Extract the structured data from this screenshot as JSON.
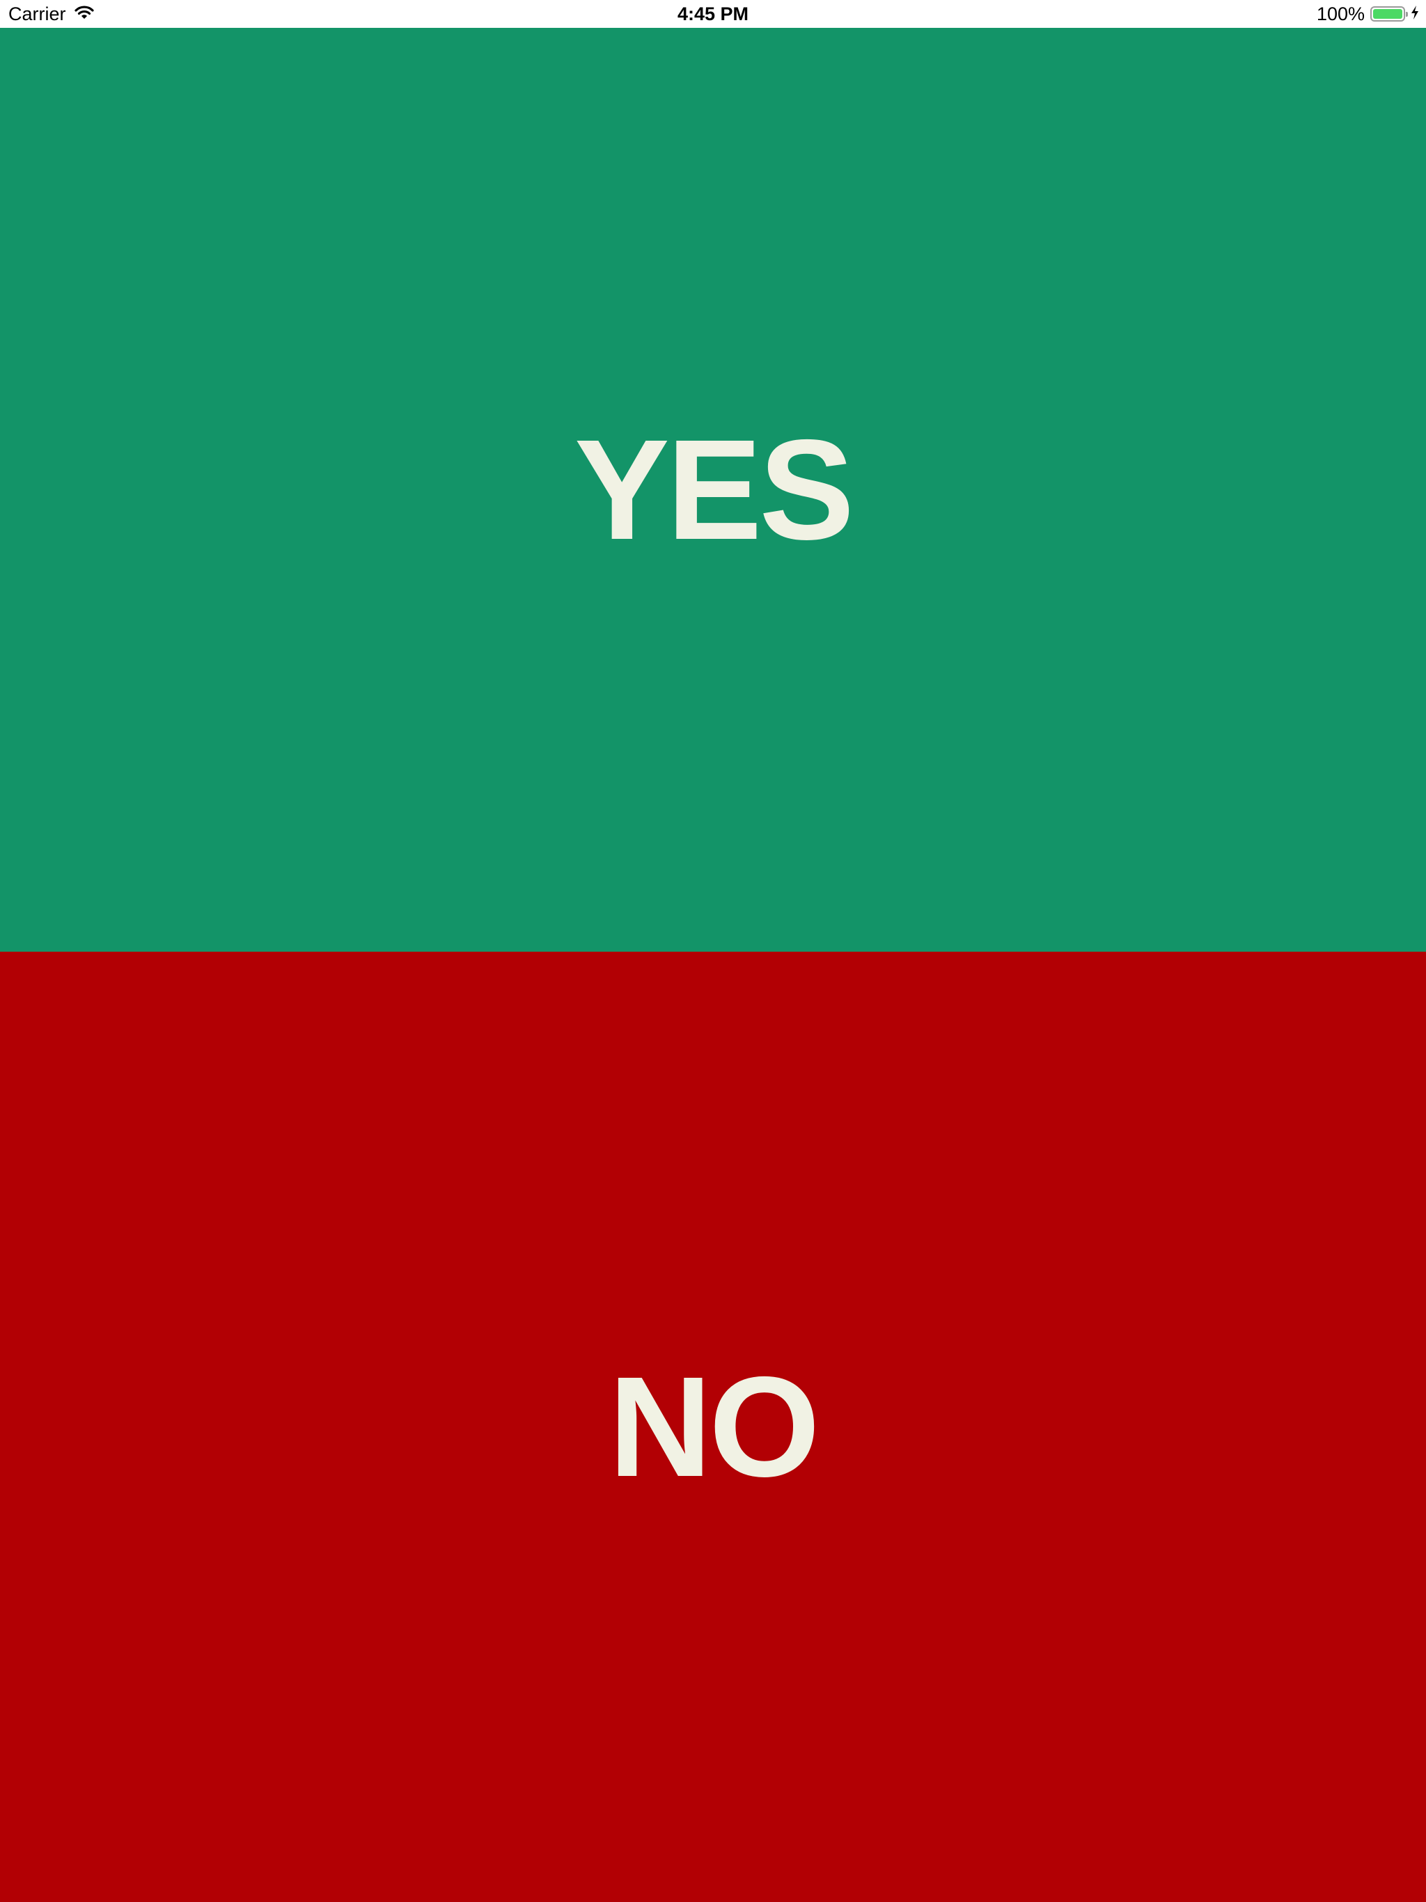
{
  "status_bar": {
    "carrier": "Carrier",
    "time": "4:45 PM",
    "battery_percent": "100%",
    "battery_level": 1.0,
    "icons": [
      "wifi-icon",
      "battery-icon",
      "charging-bolt-icon"
    ]
  },
  "yes_panel": {
    "label": "YES",
    "background_color": "#139468",
    "text_color": "#f1f2e4"
  },
  "no_panel": {
    "label": "NO",
    "background_color": "#b20004",
    "text_color": "#f1f2e4"
  }
}
